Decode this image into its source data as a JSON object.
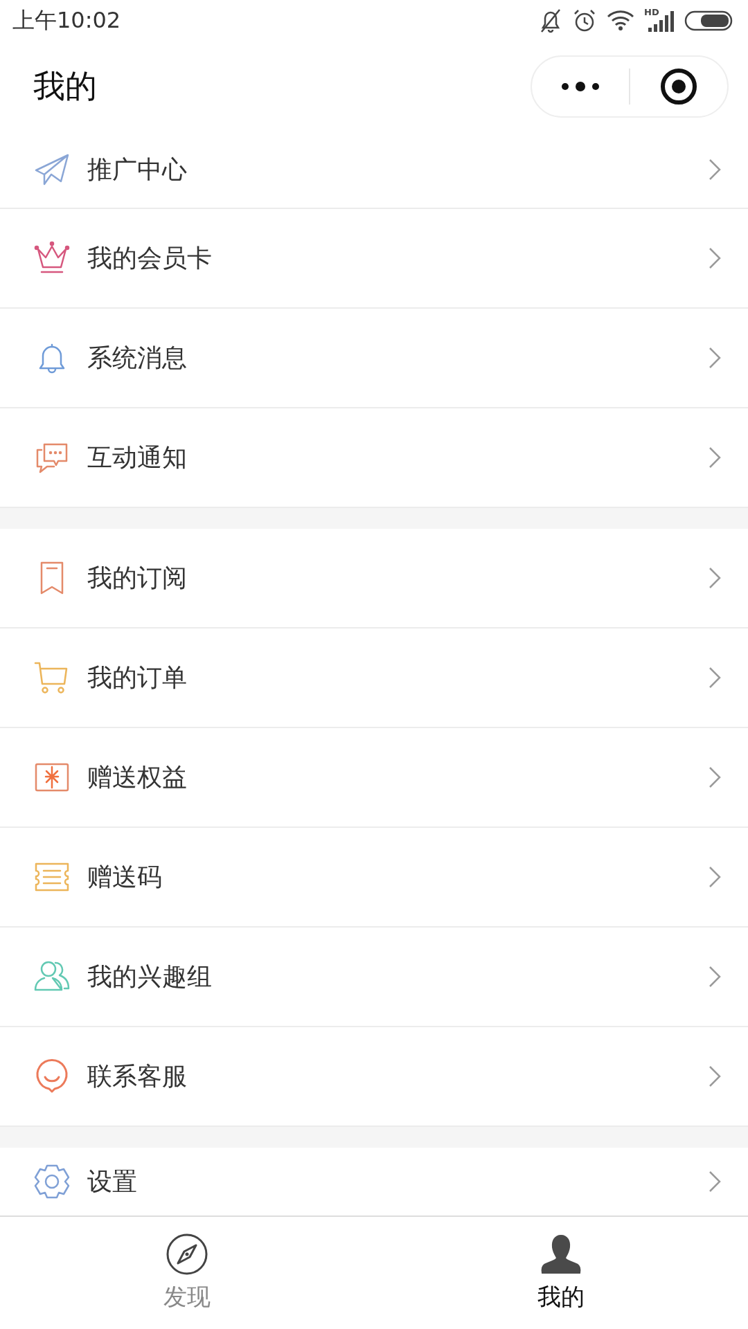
{
  "status_bar": {
    "time": "上午10:02",
    "network_label": "HD"
  },
  "header": {
    "title": "我的"
  },
  "groups": [
    [
      {
        "label": "推广中心",
        "kind": "plane"
      },
      {
        "label": "我的会员卡",
        "kind": "crown"
      },
      {
        "label": "系统消息",
        "kind": "bell"
      },
      {
        "label": "互动通知",
        "kind": "chat"
      }
    ],
    [
      {
        "label": "我的订阅",
        "kind": "bookmark"
      },
      {
        "label": "我的订单",
        "kind": "cart"
      },
      {
        "label": "赠送权益",
        "kind": "gift"
      },
      {
        "label": "赠送码",
        "kind": "ticket"
      },
      {
        "label": "我的兴趣组",
        "kind": "group"
      },
      {
        "label": "联系客服",
        "kind": "service"
      }
    ],
    [
      {
        "label": "设置",
        "kind": "gear"
      }
    ]
  ],
  "tabs": [
    {
      "label": "发现",
      "kind": "discover",
      "selected": false
    },
    {
      "label": "我的",
      "kind": "me",
      "selected": true
    }
  ]
}
